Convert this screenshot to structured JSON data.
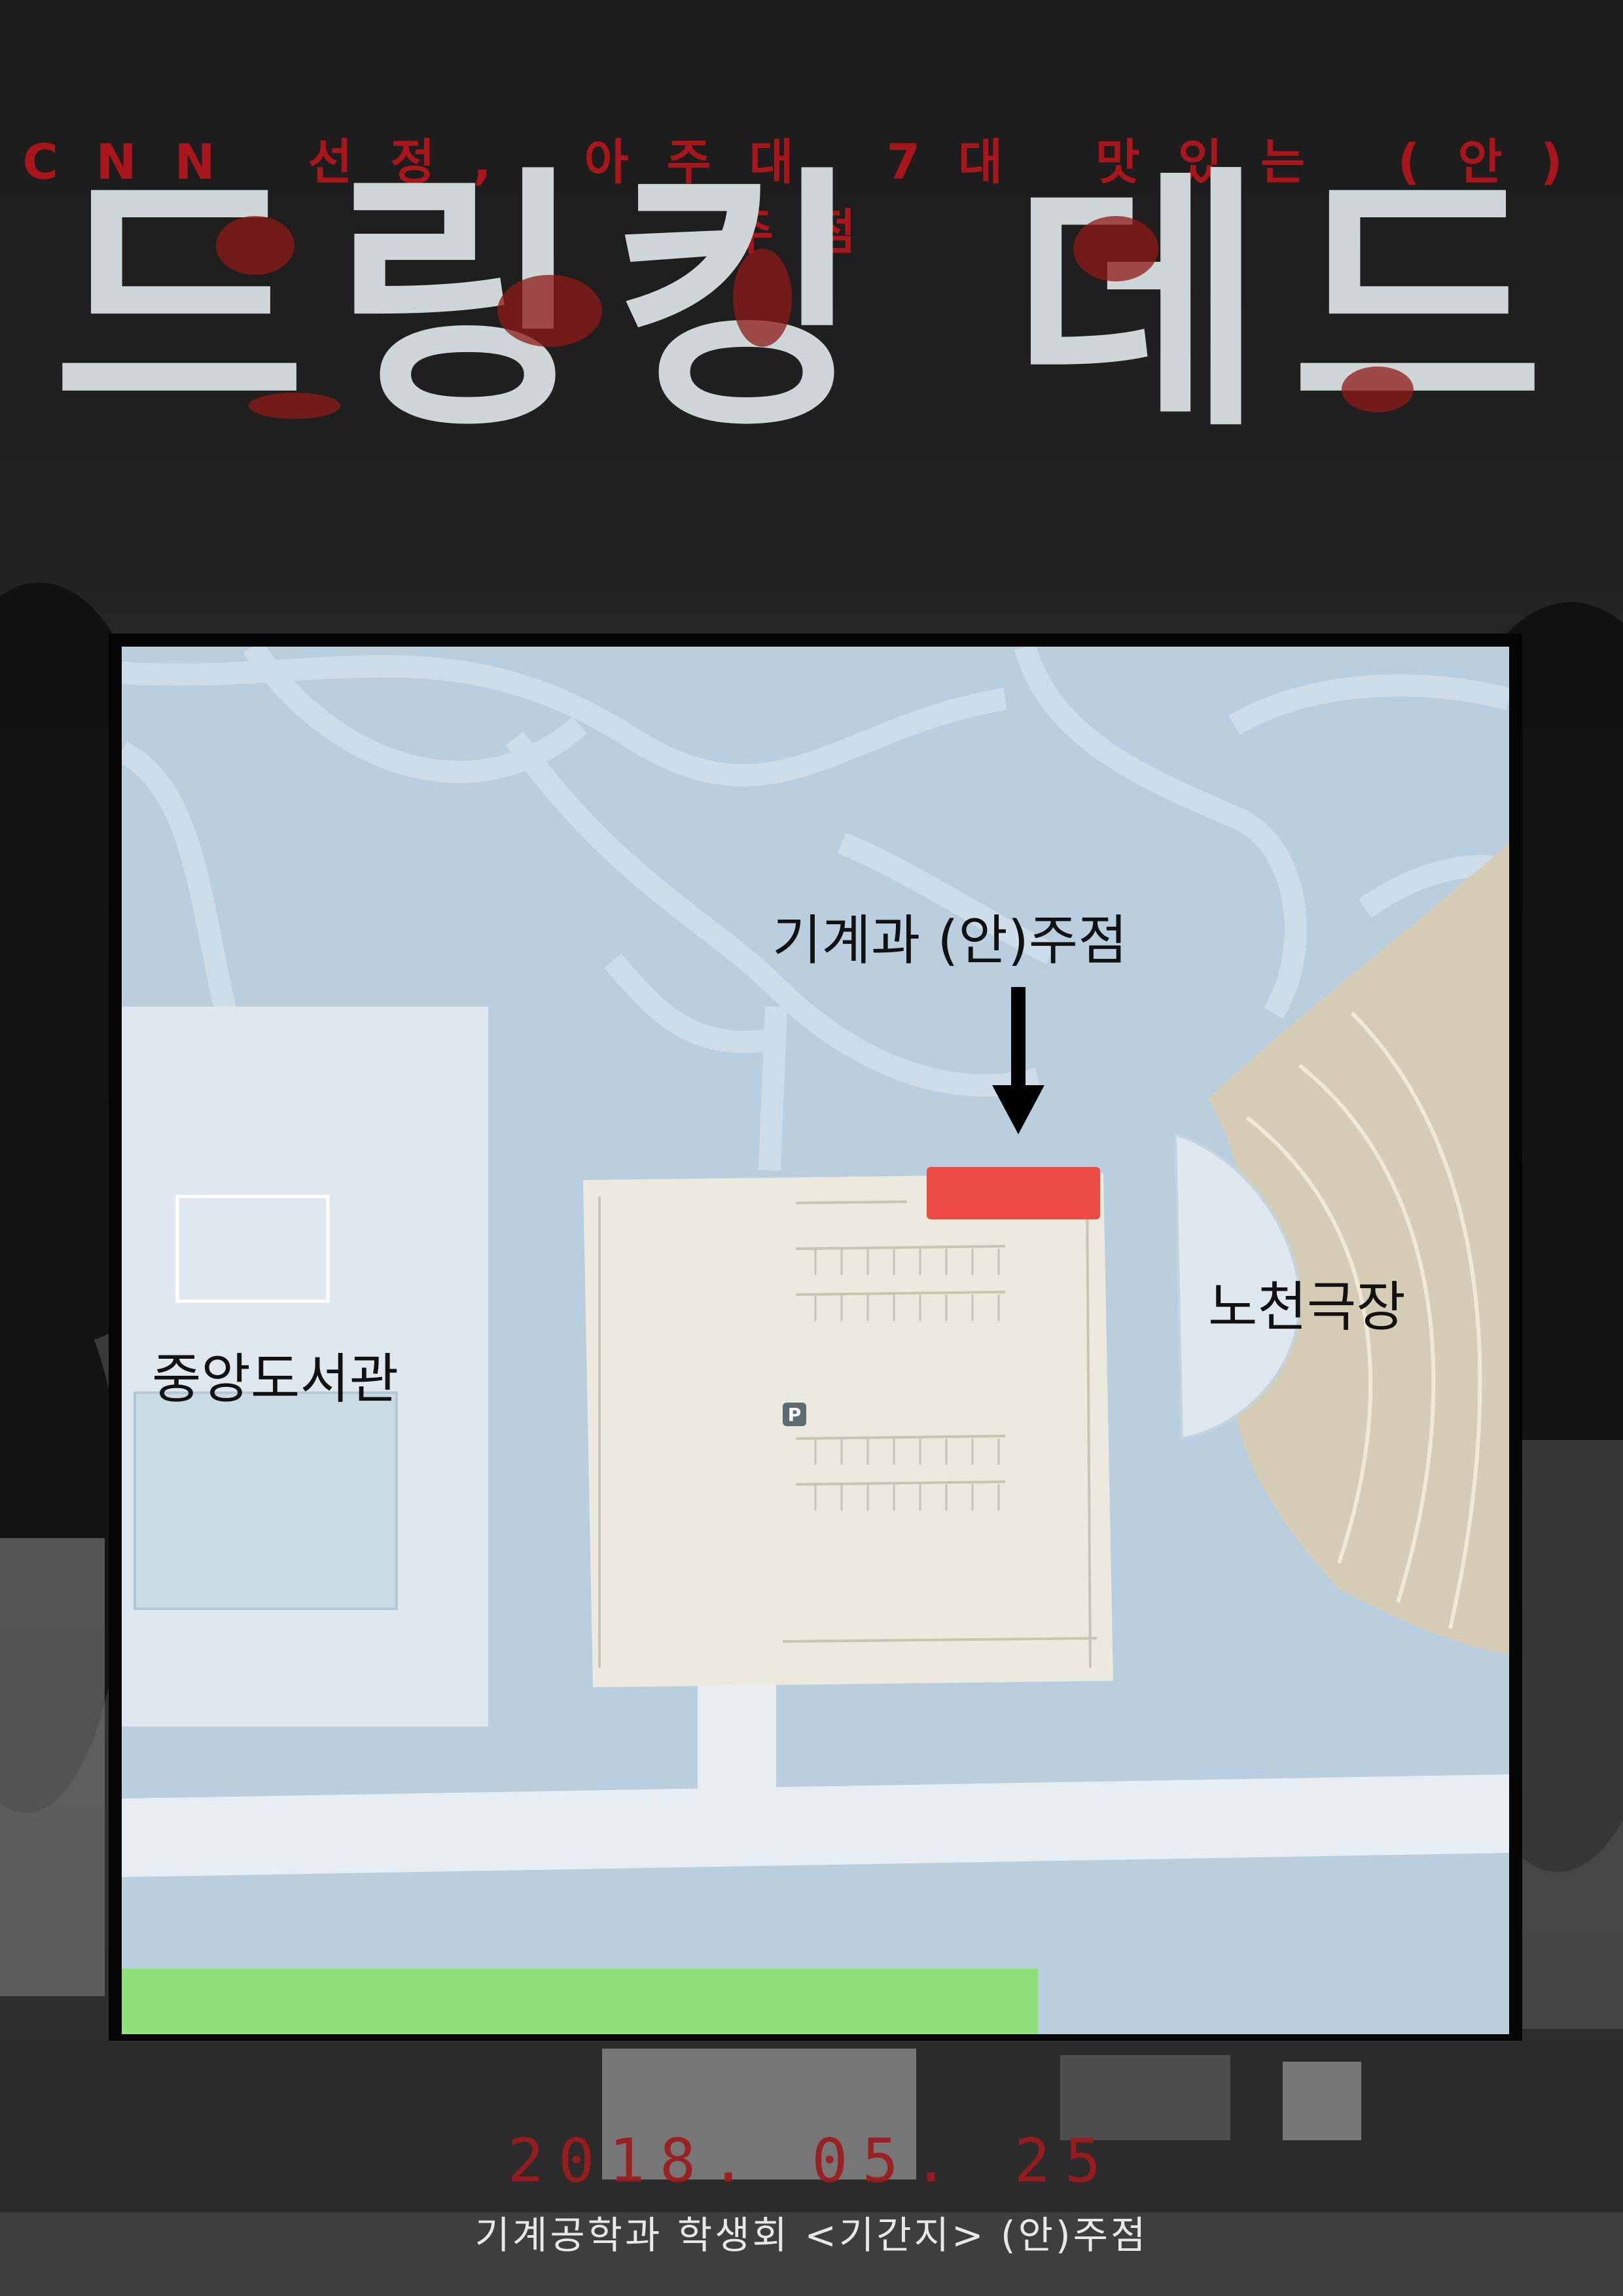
{
  "poster": {
    "tagline": "CNN 선정, 아주대 7대 맛있는 (안)주점",
    "title": "드링킹 데드",
    "date": "2018. 05. 25",
    "footer": "기계공학과 학생회 <기간지> (안)주점"
  },
  "map": {
    "labels": {
      "booth": "기계과 (안)주점",
      "library": "중앙도서관",
      "theater": "노천극장"
    },
    "parking_symbol": "P",
    "colors": {
      "booth_marker": "#ef4b45",
      "ground": "#b9cfdf",
      "road": "#e6eef4",
      "building": "#dfe8ef",
      "parking_lot": "#ece9df",
      "theater": "#d5cdb5",
      "field": "#8fe07a"
    },
    "icons": [
      "down-arrow-icon",
      "parking-icon"
    ]
  }
}
